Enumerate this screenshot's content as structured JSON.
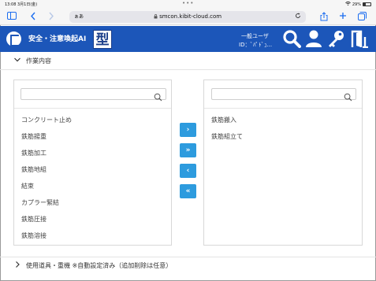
{
  "status_bar": {
    "time": "13:08  3月1日(金)",
    "dots": "•••",
    "battery": "29%"
  },
  "browser": {
    "aa_label": "ぁあ",
    "url": "smcon.kibit-cloud.com"
  },
  "app_header": {
    "title": "安全・注意喚起AI",
    "kata_logo": "型",
    "user_type": "一般ユーザ",
    "user_id": "ID：ﾞﾊﾟﾄﾞｭ..."
  },
  "sections": {
    "work_content": "作業内容",
    "tools_machines": "使用道具・重機 ※自動設定済み（追加削除は任意）"
  },
  "left_list": {
    "search_value": "",
    "items": [
      "コンクリート止め",
      "鉄筋揚重",
      "鉄筋加工",
      "鉄筋地組",
      "結束",
      "カプラー緊結",
      "鉄筋圧接",
      "鉄筋溶接"
    ]
  },
  "right_list": {
    "search_value": "",
    "items": [
      "鉄筋搬入",
      "鉄筋組立て"
    ]
  },
  "transfer_buttons": {
    "move_right": "›",
    "move_all_right": "»",
    "move_left": "‹",
    "move_all_left": "«"
  },
  "colors": {
    "header_blue": "#1c56b9",
    "button_blue": "#2d9bde",
    "safari_blue": "#1a6cf0"
  }
}
